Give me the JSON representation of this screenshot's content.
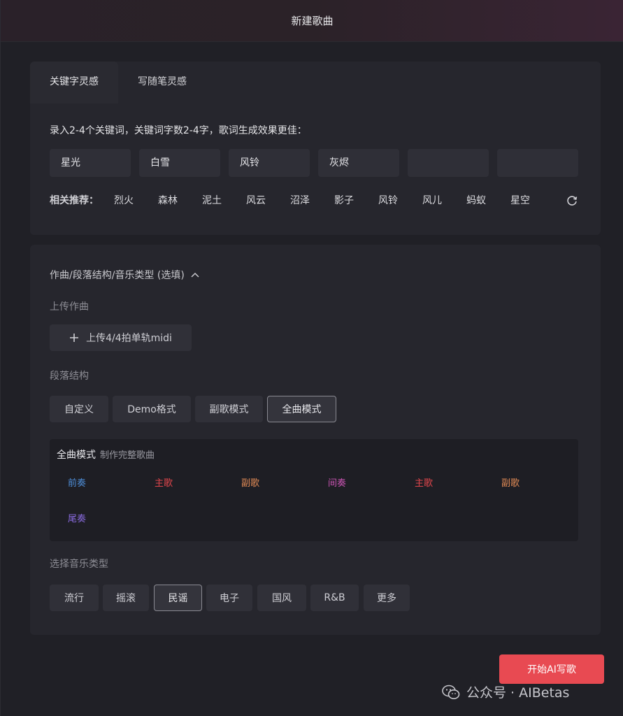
{
  "dialog": {
    "title": "新建歌曲"
  },
  "tabs": [
    {
      "label": "关键字灵感"
    },
    {
      "label": "写随笔灵感"
    }
  ],
  "keywords": {
    "prompt": "录入2-4个关键词，关键词字数2-4字，歌词生成效果更佳：",
    "inputs": [
      {
        "value": "星光"
      },
      {
        "value": "白雪"
      },
      {
        "value": "风铃"
      },
      {
        "value": "灰烬"
      },
      {
        "value": ""
      },
      {
        "value": ""
      }
    ],
    "recommend_label": "相关推荐：",
    "recommendations": [
      "烈火",
      "森林",
      "泥土",
      "风云",
      "沼泽",
      "影子",
      "风铃",
      "风儿",
      "蚂蚁",
      "星空"
    ],
    "refresh_icon": "refresh-icon"
  },
  "options": {
    "title": "作曲/段落结构/音乐类型 (选填)",
    "upload": {
      "label": "上传作曲",
      "button": "上传4/4拍单轨midi"
    },
    "structure": {
      "label": "段落结构",
      "modes": [
        "自定义",
        "Demo格式",
        "副歌模式",
        "全曲模式"
      ],
      "selected": "全曲模式",
      "detail": {
        "name": "全曲模式",
        "desc": "制作完整歌曲",
        "segments": [
          {
            "label": "前奏",
            "color": "#4e8ed8"
          },
          {
            "label": "主歌",
            "color": "#e0454b"
          },
          {
            "label": "副歌",
            "color": "#e08a55"
          },
          {
            "label": "间奏",
            "color": "#cc55b5"
          },
          {
            "label": "主歌",
            "color": "#e0454b"
          },
          {
            "label": "副歌",
            "color": "#e08a55"
          },
          {
            "label": "尾奏",
            "color": "#8a6be0"
          }
        ]
      }
    },
    "genre": {
      "label": "选择音乐类型",
      "items": [
        "流行",
        "摇滚",
        "民谣",
        "电子",
        "国风",
        "R&B",
        "更多"
      ],
      "selected": "民谣"
    }
  },
  "cta": {
    "label": "开始AI写歌",
    "color": "#e84a52"
  },
  "watermark": {
    "text": "公众号 · AIBetas",
    "icon": "wechat-icon"
  }
}
